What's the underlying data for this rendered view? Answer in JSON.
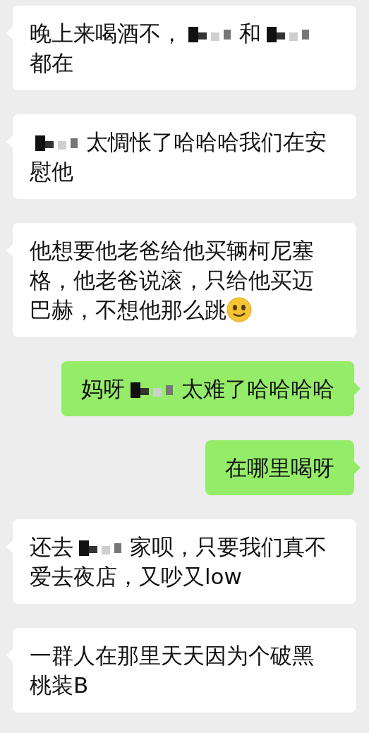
{
  "messages": [
    {
      "sent": false,
      "lines": [
        [
          {
            "kind": "text",
            "text": "晚上来喝酒不，"
          },
          {
            "kind": "redacted"
          },
          {
            "kind": "text",
            "text": "和"
          },
          {
            "kind": "redacted"
          }
        ],
        [
          {
            "kind": "text",
            "text": "都在"
          }
        ]
      ]
    },
    {
      "sent": false,
      "lines": [
        [
          {
            "kind": "redacted"
          },
          {
            "kind": "text",
            "text": "太惆怅了哈哈哈我们在安"
          }
        ],
        [
          {
            "kind": "text",
            "text": "慰他"
          }
        ]
      ]
    },
    {
      "sent": false,
      "lines": [
        [
          {
            "kind": "text",
            "text": "他想要他老爸给他买辆柯尼塞"
          }
        ],
        [
          {
            "kind": "text",
            "text": "格，他老爸说滚，只给他买迈"
          }
        ],
        [
          {
            "kind": "text",
            "text": "巴赫，不想他那么跳"
          },
          {
            "kind": "emoji"
          }
        ]
      ]
    },
    {
      "sent": true,
      "lines": [
        [
          {
            "kind": "text",
            "text": "妈呀"
          },
          {
            "kind": "redacted"
          },
          {
            "kind": "text",
            "text": "太难了哈哈哈哈"
          }
        ]
      ]
    },
    {
      "sent": true,
      "lines": [
        [
          {
            "kind": "text",
            "text": "在哪里喝呀"
          }
        ]
      ]
    },
    {
      "sent": false,
      "lines": [
        [
          {
            "kind": "text",
            "text": "还去"
          },
          {
            "kind": "redacted"
          },
          {
            "kind": "text",
            "text": "家呗，只要我们真不"
          }
        ],
        [
          {
            "kind": "text",
            "text": "爱去夜店，又吵又low"
          }
        ]
      ]
    },
    {
      "sent": false,
      "lines": [
        [
          {
            "kind": "text",
            "text": "一群人在那里天天因为个破黑"
          }
        ],
        [
          {
            "kind": "text",
            "text": "桃装B"
          }
        ]
      ]
    }
  ]
}
